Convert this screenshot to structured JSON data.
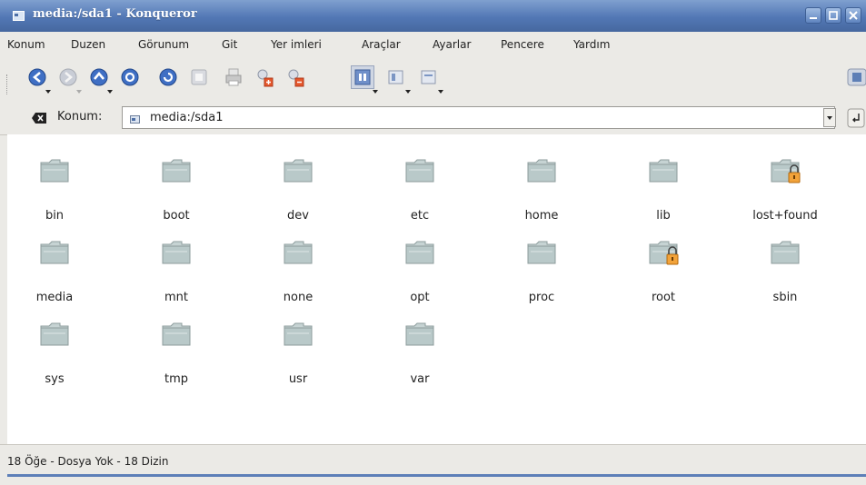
{
  "window": {
    "title": "media:/sda1 - Konqueror"
  },
  "menu": [
    {
      "label": "Konum"
    },
    {
      "label": "Duzen"
    },
    {
      "label": "Görunum"
    },
    {
      "label": "Git"
    },
    {
      "label": "Yer imleri"
    },
    {
      "label": "Araçlar"
    },
    {
      "label": "Ayarlar"
    },
    {
      "label": "Pencere"
    },
    {
      "label": "Yardım"
    }
  ],
  "toolbar": {
    "buttons": [
      {
        "icon": "back-arrow-icon"
      },
      {
        "icon": "forward-arrow-icon"
      },
      {
        "icon": "up-arrow-icon"
      },
      {
        "icon": "home-icon"
      },
      {
        "icon": "reload-icon"
      },
      {
        "icon": "stop-icon"
      },
      {
        "icon": "print-icon"
      },
      {
        "icon": "zoom-in-icon"
      },
      {
        "icon": "zoom-out-icon"
      },
      {
        "icon": "icon-view-icon"
      },
      {
        "icon": "detail-view-icon"
      },
      {
        "icon": "text-view-icon"
      },
      {
        "icon": "activity-throbber-icon"
      }
    ]
  },
  "location": {
    "label": "Konum:",
    "value": "media:/sda1"
  },
  "files": [
    {
      "name": "bin",
      "locked": false
    },
    {
      "name": "boot",
      "locked": false
    },
    {
      "name": "dev",
      "locked": false
    },
    {
      "name": "etc",
      "locked": false
    },
    {
      "name": "home",
      "locked": false
    },
    {
      "name": "lib",
      "locked": false
    },
    {
      "name": "lost+found",
      "locked": true
    },
    {
      "name": "media",
      "locked": false
    },
    {
      "name": "mnt",
      "locked": false
    },
    {
      "name": "none",
      "locked": false
    },
    {
      "name": "opt",
      "locked": false
    },
    {
      "name": "proc",
      "locked": false
    },
    {
      "name": "root",
      "locked": true
    },
    {
      "name": "sbin",
      "locked": false
    },
    {
      "name": "sys",
      "locked": false
    },
    {
      "name": "tmp",
      "locked": false
    },
    {
      "name": "usr",
      "locked": false
    },
    {
      "name": "var",
      "locked": false
    }
  ],
  "status": {
    "text": "18 Öğe - Dosya Yok - 18 Dizin"
  },
  "colors": {
    "titlebar": "#5277b5",
    "folder": "#b9c9c9",
    "lock": "#f2a33a"
  }
}
